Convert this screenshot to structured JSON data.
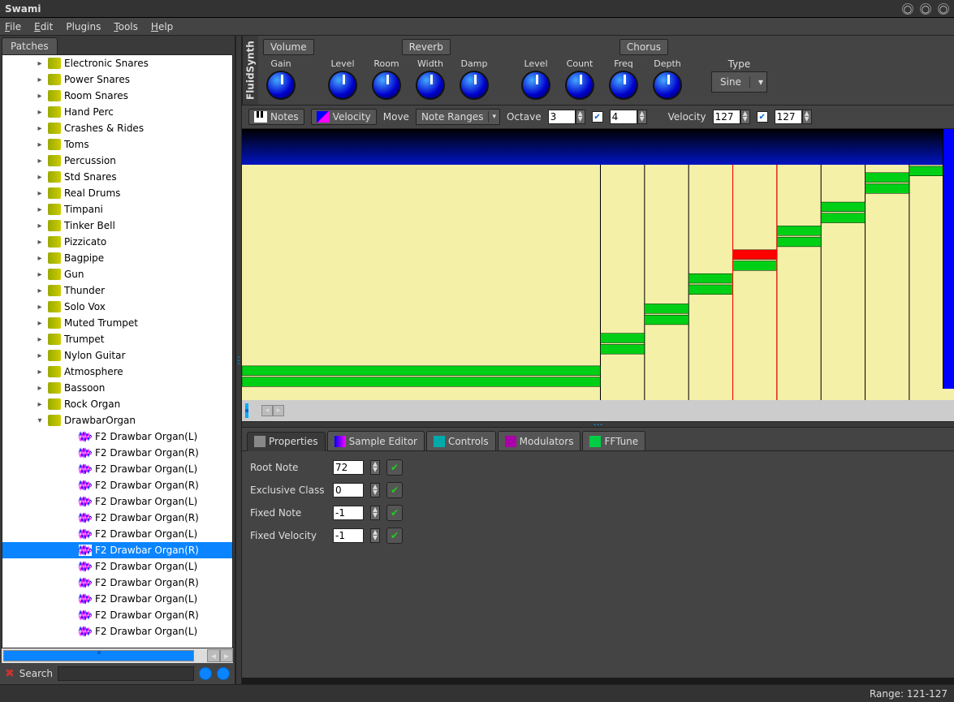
{
  "window": {
    "title": "Swami"
  },
  "menus": [
    "File",
    "Edit",
    "Plugins",
    "Tools",
    "Help"
  ],
  "patches_tab": "Patches",
  "tree": {
    "items": [
      {
        "icon": "preset",
        "label": "Electronic Snares",
        "arrow": "right",
        "indent": 30
      },
      {
        "icon": "preset",
        "label": "Power Snares",
        "arrow": "right",
        "indent": 30
      },
      {
        "icon": "preset",
        "label": "Room Snares",
        "arrow": "right",
        "indent": 30
      },
      {
        "icon": "preset",
        "label": "Hand Perc",
        "arrow": "right",
        "indent": 30
      },
      {
        "icon": "preset",
        "label": "Crashes & Rides",
        "arrow": "right",
        "indent": 30
      },
      {
        "icon": "preset",
        "label": "Toms",
        "arrow": "right",
        "indent": 30
      },
      {
        "icon": "preset",
        "label": "Percussion",
        "arrow": "right",
        "indent": 30
      },
      {
        "icon": "preset",
        "label": "Std Snares",
        "arrow": "right",
        "indent": 30
      },
      {
        "icon": "preset",
        "label": "Real Drums",
        "arrow": "right",
        "indent": 30
      },
      {
        "icon": "preset",
        "label": "Timpani",
        "arrow": "right",
        "indent": 30
      },
      {
        "icon": "preset",
        "label": "Tinker Bell",
        "arrow": "right",
        "indent": 30
      },
      {
        "icon": "preset",
        "label": "Pizzicato",
        "arrow": "right",
        "indent": 30
      },
      {
        "icon": "preset",
        "label": "Bagpipe",
        "arrow": "right",
        "indent": 30
      },
      {
        "icon": "preset",
        "label": "Gun",
        "arrow": "right",
        "indent": 30
      },
      {
        "icon": "preset",
        "label": "Thunder",
        "arrow": "right",
        "indent": 30
      },
      {
        "icon": "preset",
        "label": "Solo Vox",
        "arrow": "right",
        "indent": 30
      },
      {
        "icon": "preset",
        "label": "Muted Trumpet",
        "arrow": "right",
        "indent": 30
      },
      {
        "icon": "preset",
        "label": "Trumpet",
        "arrow": "right",
        "indent": 30
      },
      {
        "icon": "preset",
        "label": "Nylon Guitar",
        "arrow": "right",
        "indent": 30
      },
      {
        "icon": "preset",
        "label": "Atmosphere",
        "arrow": "right",
        "indent": 30
      },
      {
        "icon": "preset",
        "label": "Bassoon",
        "arrow": "right",
        "indent": 30
      },
      {
        "icon": "preset",
        "label": "Rock Organ",
        "arrow": "right",
        "indent": 30
      },
      {
        "icon": "preset",
        "label": "DrawbarOrgan",
        "arrow": "down",
        "indent": 30
      },
      {
        "icon": "sample",
        "label": "F2 Drawbar Organ(L)",
        "arrow": "",
        "indent": 68
      },
      {
        "icon": "sample",
        "label": "F2 Drawbar Organ(R)",
        "arrow": "",
        "indent": 68
      },
      {
        "icon": "sample",
        "label": "F2 Drawbar Organ(L)",
        "arrow": "",
        "indent": 68
      },
      {
        "icon": "sample",
        "label": "F2 Drawbar Organ(R)",
        "arrow": "",
        "indent": 68
      },
      {
        "icon": "sample",
        "label": "F2 Drawbar Organ(L)",
        "arrow": "",
        "indent": 68
      },
      {
        "icon": "sample",
        "label": "F2 Drawbar Organ(R)",
        "arrow": "",
        "indent": 68
      },
      {
        "icon": "sample",
        "label": "F2 Drawbar Organ(L)",
        "arrow": "",
        "indent": 68
      },
      {
        "icon": "sample",
        "label": "F2 Drawbar Organ(R)",
        "arrow": "",
        "indent": 68,
        "selected": true
      },
      {
        "icon": "sample",
        "label": "F2 Drawbar Organ(L)",
        "arrow": "",
        "indent": 68
      },
      {
        "icon": "sample",
        "label": "F2 Drawbar Organ(R)",
        "arrow": "",
        "indent": 68
      },
      {
        "icon": "sample",
        "label": "F2 Drawbar Organ(L)",
        "arrow": "",
        "indent": 68
      },
      {
        "icon": "sample",
        "label": "F2 Drawbar Organ(R)",
        "arrow": "",
        "indent": 68
      },
      {
        "icon": "sample",
        "label": "F2 Drawbar Organ(L)",
        "arrow": "",
        "indent": 68
      }
    ]
  },
  "search": {
    "label": "Search",
    "value": ""
  },
  "synth": {
    "label": "FluidSynth",
    "sections": {
      "volume": "Volume",
      "reverb": "Reverb",
      "chorus": "Chorus"
    },
    "knobs": {
      "gain": "Gain",
      "rev_level": "Level",
      "rev_room": "Room",
      "rev_width": "Width",
      "rev_damp": "Damp",
      "cho_level": "Level",
      "cho_count": "Count",
      "cho_freq": "Freq",
      "cho_depth": "Depth"
    },
    "type_label": "Type",
    "type_value": "Sine"
  },
  "toolbar": {
    "notes": "Notes",
    "velocity": "Velocity",
    "move": "Move",
    "move_mode": "Note Ranges",
    "octave_label": "Octave",
    "octave1": "3",
    "octave2": "4",
    "velocity_label": "Velocity",
    "vel1": "127",
    "vel2": "127"
  },
  "btabs": {
    "properties": "Properties",
    "sample_editor": "Sample Editor",
    "controls": "Controls",
    "modulators": "Modulators",
    "fftune": "FFTune"
  },
  "props": {
    "root_note_label": "Root Note",
    "root_note": "72",
    "excl_class_label": "Exclusive Class",
    "excl_class": "0",
    "fixed_note_label": "Fixed Note",
    "fixed_note": "-1",
    "fixed_vel_label": "Fixed Velocity",
    "fixed_vel": "-1"
  },
  "status": "Range: 121-127",
  "chart_data": {
    "type": "range-map",
    "description": "Sample note-range zones, x = note number 0-127, stacked green bars per zone; selected zone red",
    "zones": [
      {
        "low": 0,
        "high": 64,
        "y": 17,
        "h": 12,
        "color": "#00d015"
      },
      {
        "low": 0,
        "high": 64,
        "y": 31,
        "h": 12,
        "color": "#00d015"
      },
      {
        "low": 65,
        "high": 72,
        "y": 58,
        "h": 12,
        "color": "#00d015"
      },
      {
        "low": 65,
        "high": 72,
        "y": 72,
        "h": 12,
        "color": "#00d015"
      },
      {
        "low": 73,
        "high": 80,
        "y": 95,
        "h": 12,
        "color": "#00d015"
      },
      {
        "low": 73,
        "high": 80,
        "y": 109,
        "h": 12,
        "color": "#00d015"
      },
      {
        "low": 81,
        "high": 88,
        "y": 133,
        "h": 12,
        "color": "#00d015"
      },
      {
        "low": 81,
        "high": 88,
        "y": 147,
        "h": 12,
        "color": "#00d015"
      },
      {
        "low": 89,
        "high": 96,
        "y": 163,
        "h": 12,
        "color": "#00d015"
      },
      {
        "low": 89,
        "high": 96,
        "y": 177,
        "h": 12,
        "color": "#ff0000",
        "selected": true
      },
      {
        "low": 97,
        "high": 104,
        "y": 193,
        "h": 12,
        "color": "#00d015"
      },
      {
        "low": 97,
        "high": 104,
        "y": 207,
        "h": 12,
        "color": "#00d015"
      },
      {
        "low": 105,
        "high": 112,
        "y": 223,
        "h": 12,
        "color": "#00d015"
      },
      {
        "low": 105,
        "high": 112,
        "y": 237,
        "h": 12,
        "color": "#00d015"
      },
      {
        "low": 113,
        "high": 120,
        "y": 260,
        "h": 12,
        "color": "#00d015"
      },
      {
        "low": 113,
        "high": 120,
        "y": 274,
        "h": 12,
        "color": "#00d015"
      },
      {
        "low": 121,
        "high": 127,
        "y": 282,
        "h": 12,
        "color": "#00d015"
      },
      {
        "low": 121,
        "high": 127,
        "y": 296,
        "h": 12,
        "color": "#00d015"
      }
    ],
    "ticks": [
      65,
      73,
      81,
      89,
      97,
      105,
      113,
      121
    ],
    "x_range": [
      0,
      127
    ]
  }
}
